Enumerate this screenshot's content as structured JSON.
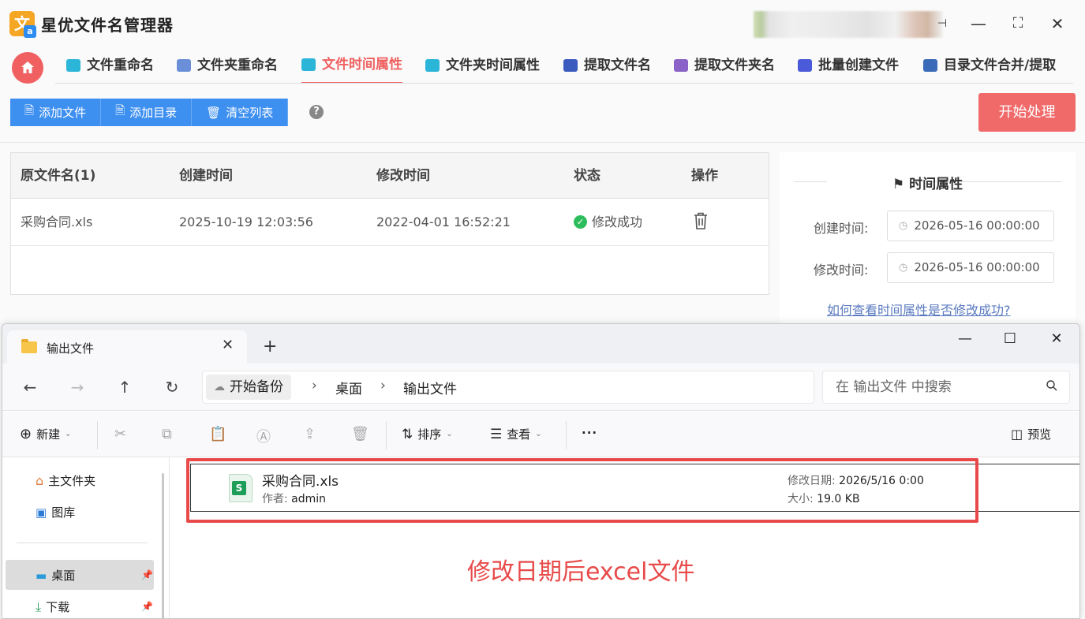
{
  "app": {
    "title": "星优文件名管理器",
    "window_controls": [
      "minimize",
      "maximize",
      "close"
    ]
  },
  "tabs": [
    {
      "label": "文件重命名",
      "icon": "rename-icon",
      "color": "#2bb5d8"
    },
    {
      "label": "文件夹重命名",
      "icon": "folder-rename-icon",
      "color": "#6a8fd8"
    },
    {
      "label": "文件时间属性",
      "icon": "file-time-icon",
      "color": "#2bb5d8"
    },
    {
      "label": "文件夹时间属性",
      "icon": "folder-time-icon",
      "color": "#2bb5d8"
    },
    {
      "label": "提取文件名",
      "icon": "extract-file-icon",
      "color": "#3b5bbf"
    },
    {
      "label": "提取文件夹名",
      "icon": "extract-folder-icon",
      "color": "#8a62c8"
    },
    {
      "label": "批量创建文件",
      "icon": "batch-create-icon",
      "color": "#4a5ad8"
    },
    {
      "label": "目录文件合并/提取",
      "icon": "merge-icon",
      "color": "#3a6ab8"
    }
  ],
  "active_tab": "文件时间属性",
  "toolbar": {
    "add_file": "添加文件",
    "add_dir": "添加目录",
    "clear_list": "清空列表",
    "help": "?",
    "start": "开始处理"
  },
  "table": {
    "headers": [
      "原文件名(1)",
      "创建时间",
      "修改时间",
      "状态",
      "操作"
    ],
    "rows": [
      {
        "name": "采购合同.xls",
        "created": "2025-10-19 12:03:56",
        "modified": "2022-04-01 16:52:21",
        "status": "修改成功"
      }
    ]
  },
  "panel": {
    "title": "时间属性",
    "created_label": "创建时间:",
    "created_value": "2026-05-16 00:00:00",
    "modified_label": "修改时间:",
    "modified_value": "2026-05-16 00:00:00",
    "link": "如何查看时间属性是否修改成功?"
  },
  "explorer": {
    "tab_title": "输出文件",
    "breadcrumb": [
      "开始备份",
      "桌面",
      "输出文件"
    ],
    "search_placeholder": "在 输出文件 中搜索",
    "commands": {
      "new": "新建",
      "sort": "排序",
      "view": "查看",
      "more": "···",
      "preview": "预览"
    },
    "sidebar": [
      {
        "label": "主文件夹",
        "icon": "home-icon"
      },
      {
        "label": "图库",
        "icon": "gallery-icon"
      },
      {
        "label": "桌面",
        "icon": "desktop-icon",
        "selected": true
      },
      {
        "label": "下载",
        "icon": "download-icon"
      }
    ],
    "file": {
      "name": "采购合同.xls",
      "author_label": "作者:",
      "author": "admin",
      "modified_label": "修改日期:",
      "modified": "2026/5/16 0:00",
      "size_label": "大小:",
      "size": "19.0 KB"
    }
  },
  "annotation": "修改日期后excel文件",
  "colors": {
    "accent": "#f06060",
    "primary": "#3d8ff0",
    "success": "#2ebd5d",
    "annotation": "#e84a4a"
  }
}
